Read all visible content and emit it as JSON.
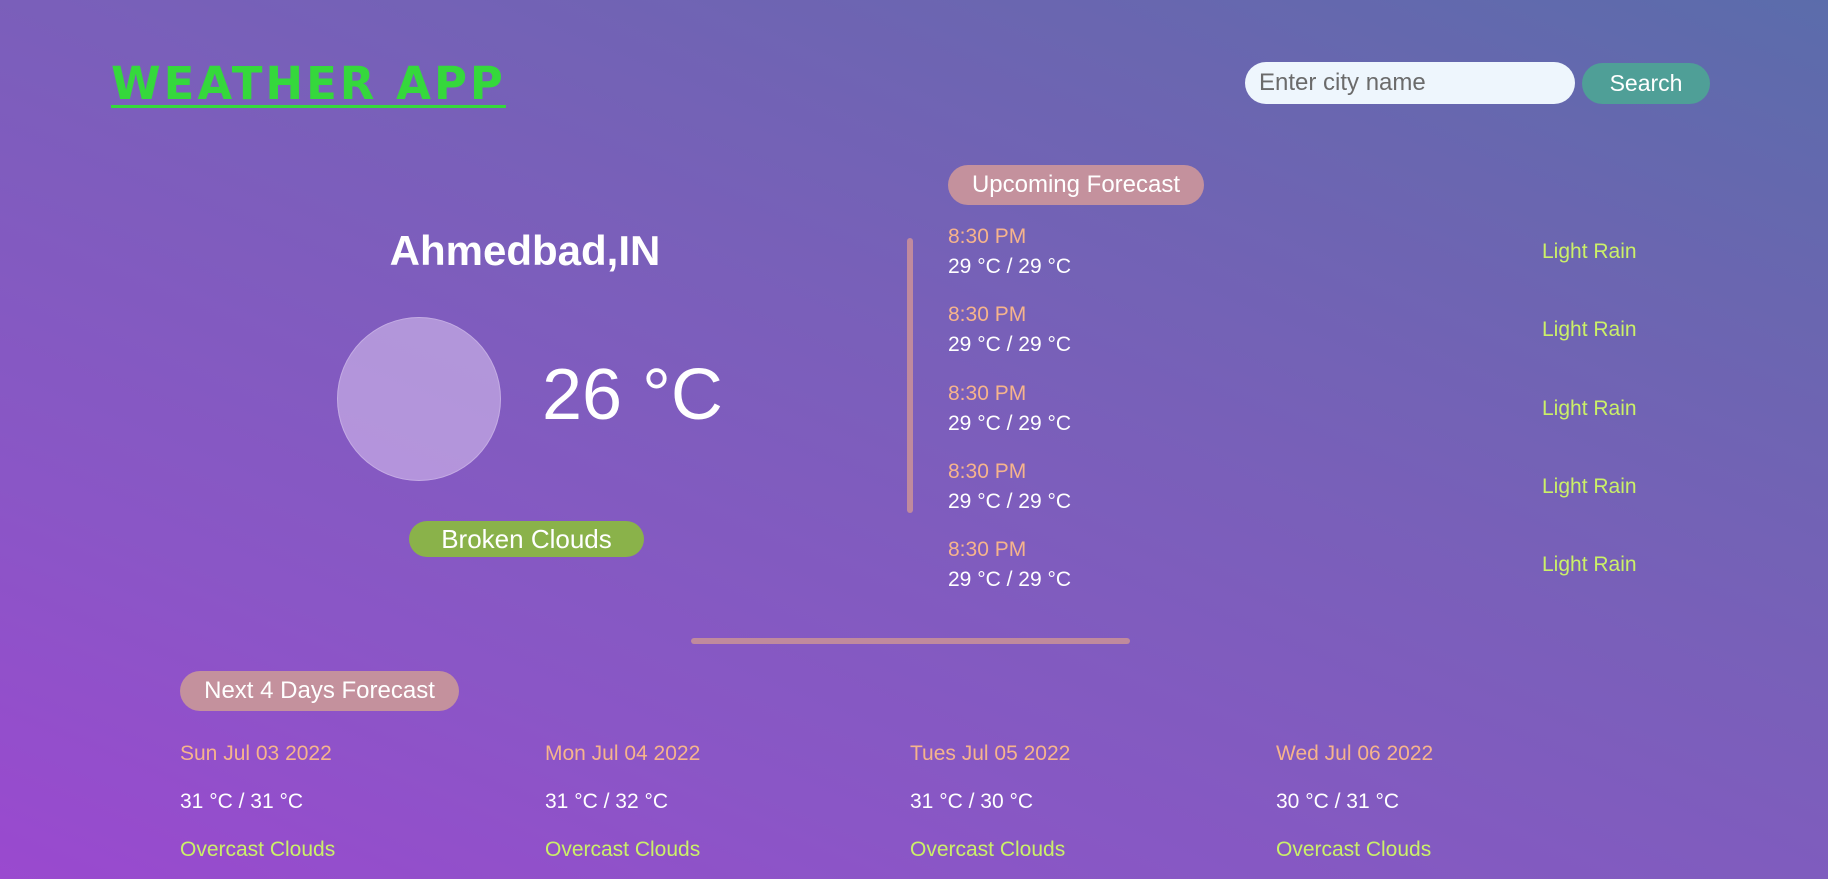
{
  "header": {
    "logo": "WEATHER APP",
    "search_placeholder": "Enter city name",
    "search_button": "Search"
  },
  "current": {
    "city": "Ahmedbad,IN",
    "temperature": "26 °C",
    "condition": "Broken Clouds",
    "icon": "weather-icon"
  },
  "upcoming": {
    "title": "Upcoming Forecast",
    "items": [
      {
        "time": "8:30 PM",
        "temps": "29 °C / 29 °C",
        "condition": "Light Rain"
      },
      {
        "time": "8:30 PM",
        "temps": "29 °C / 29 °C",
        "condition": "Light Rain"
      },
      {
        "time": "8:30 PM",
        "temps": "29 °C / 29 °C",
        "condition": "Light Rain"
      },
      {
        "time": "8:30 PM",
        "temps": "29 °C / 29 °C",
        "condition": "Light Rain"
      },
      {
        "time": "8:30 PM",
        "temps": "29 °C / 29 °C",
        "condition": "Light Rain"
      }
    ]
  },
  "next_days": {
    "title": "Next 4 Days Forecast",
    "items": [
      {
        "date": "Sun Jul 03 2022",
        "temps": "31 °C / 31 °C",
        "condition": "Overcast Clouds"
      },
      {
        "date": "Mon Jul 04 2022",
        "temps": "31 °C / 32 °C",
        "condition": "Overcast Clouds"
      },
      {
        "date": "Tues Jul 05 2022",
        "temps": "31 °C / 30 °C",
        "condition": "Overcast Clouds"
      },
      {
        "date": "Wed Jul 06 2022",
        "temps": "30 °C / 31 °C",
        "condition": "Overcast Clouds"
      }
    ]
  },
  "colors": {
    "logo": "#35d83c",
    "time_text": "#f6b48c",
    "condition_text": "#cbf068",
    "badge_pink": "#c4919d",
    "badge_green": "#8ab24a",
    "search_button": "#4f9f97"
  }
}
